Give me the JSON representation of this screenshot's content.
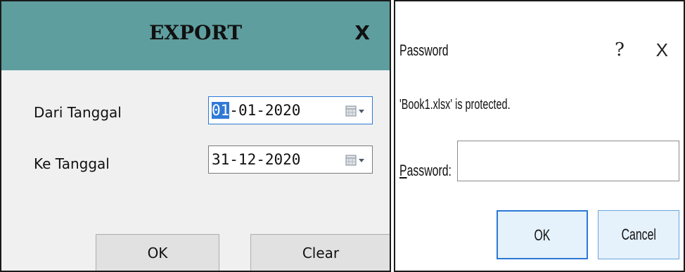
{
  "export_dialog": {
    "title": "EXPORT",
    "close_label": "X",
    "from_label": "Dari Tanggal",
    "from_value_selected": "01",
    "from_value_rest": "-01-2020",
    "to_label": "Ke Tanggal",
    "to_value": "31-12-2020",
    "ok_label": "OK",
    "clear_label": "Clear",
    "accent_color": "#5f9e9f"
  },
  "password_dialog": {
    "title": "Password",
    "help_label": "?",
    "close_label": "X",
    "message": "'Book1.xlsx' is protected.",
    "password_label_mnemonic": "P",
    "password_label_rest": "assword:",
    "password_value": "",
    "ok_label": "OK",
    "cancel_label": "Cancel"
  }
}
